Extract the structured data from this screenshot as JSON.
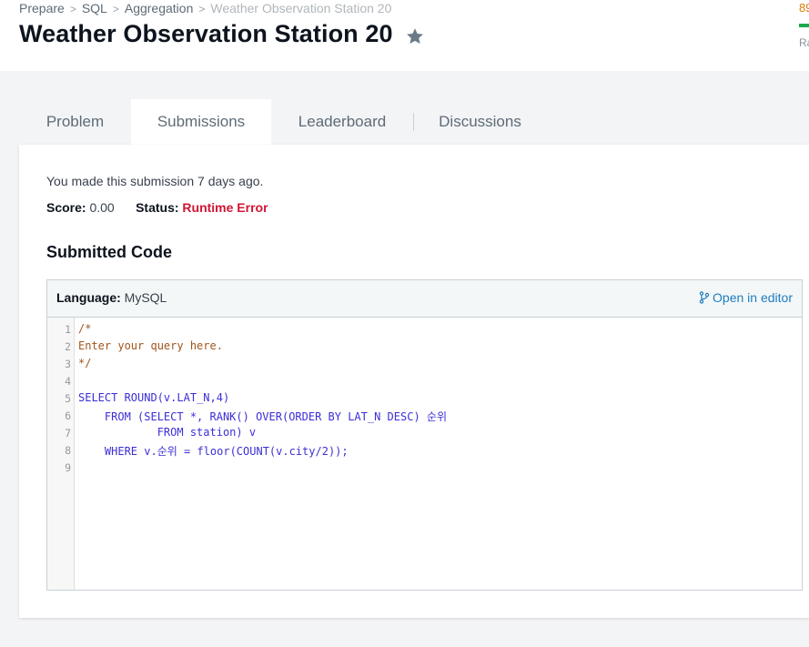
{
  "breadcrumb": {
    "items": [
      "Prepare",
      "SQL",
      "Aggregation",
      "Weather Observation Station 20"
    ]
  },
  "header": {
    "title": "Weather Observation Station 20",
    "right_score": "89",
    "right_label": "Ra"
  },
  "tabs": [
    {
      "label": "Problem",
      "active": false
    },
    {
      "label": "Submissions",
      "active": true
    },
    {
      "label": "Leaderboard",
      "active": false
    },
    {
      "label": "Discussions",
      "active": false
    }
  ],
  "submission": {
    "message": "You made this submission 7 days ago.",
    "score_label": "Score:",
    "score_value": "0.00",
    "status_label": "Status:",
    "status_value": "Runtime Error",
    "submitted_code_heading": "Submitted Code",
    "language_label": "Language:",
    "language_value": "MySQL",
    "open_in_editor": "Open in editor"
  },
  "code": {
    "line_numbers": [
      "1",
      "2",
      "3",
      "4",
      "5",
      "6",
      "7",
      "8",
      "9"
    ],
    "lines": [
      "/*",
      "Enter your query here.",
      "*/",
      "",
      "SELECT ROUND(v.LAT_N,4)",
      "    FROM (SELECT *, RANK() OVER(ORDER BY LAT_N DESC) 순위",
      "            FROM station) v",
      "    WHERE v.순위 = floor(COUNT(v.city/2));",
      ""
    ]
  },
  "colors": {
    "status_error": "#d11534",
    "link": "#1f7cc1",
    "keyword": "#3b2fd6",
    "comment": "#a0561c"
  }
}
